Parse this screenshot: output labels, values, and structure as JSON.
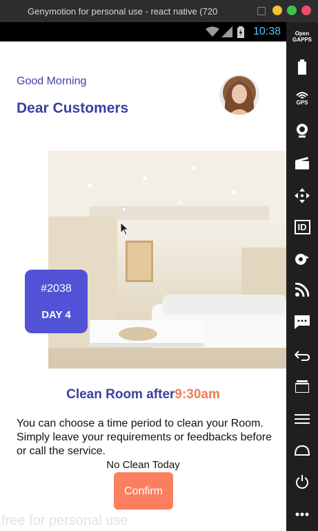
{
  "window": {
    "title": "Genymotion for personal use - react native (720",
    "watermark": "free for personal use"
  },
  "statusbar": {
    "time": "10:38"
  },
  "toolbar": {
    "opengapps_label_1": "Open",
    "opengapps_label_2": "GAPPS",
    "gps_label": "GPS",
    "id_label": "ID"
  },
  "app": {
    "greeting": "Good Morning",
    "customer_title": "Dear Customers",
    "badge": {
      "number": "#2038",
      "day": "DAY 4"
    },
    "clean_title_prefix": "Clean Room after",
    "clean_time": "9:30am",
    "description": "You can choose a time period to clean your Room. Simply leave your requirements or feedbacks before or call the service.",
    "no_clean": "No Clean Today",
    "confirm_label": "Confirm"
  },
  "colors": {
    "primary": "#3a3f9f",
    "badge": "#5252d6",
    "accent": "#f07d55",
    "confirm": "#fb7f5f"
  }
}
